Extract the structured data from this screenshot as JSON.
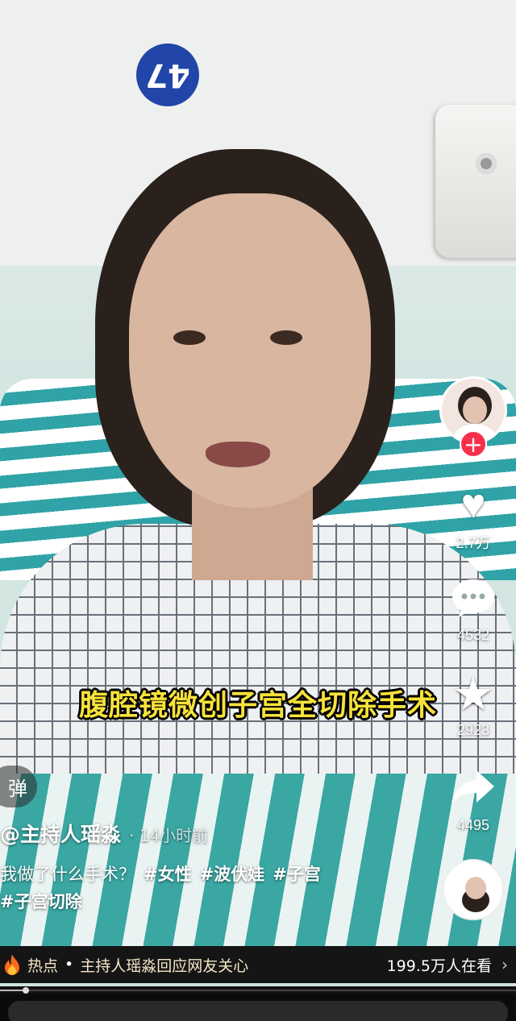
{
  "video": {
    "room_number": "47",
    "caption": "腹腔镜微创子宫全切除手术",
    "colors": {
      "caption": "#f7e23a",
      "follow": "#f6304a",
      "hot_bar": "#151515"
    }
  },
  "rail": {
    "avatar_icon": "creator-avatar",
    "follow_symbol": "+",
    "like_count": "2.7万",
    "comment_count": "4532",
    "favorite_count": "2923",
    "share_count": "4495",
    "icons": {
      "like": "heart-icon",
      "comment": "comment-bubble-icon",
      "favorite": "star-icon",
      "share": "share-arrow-icon",
      "music": "music-disc-icon"
    }
  },
  "danmu": {
    "label": "弹"
  },
  "author": {
    "name": "@主持人瑶淼",
    "time": "· 14小时前"
  },
  "description": {
    "text": "我做了什么手术？",
    "tags": [
      "#女性",
      "#波伏娃",
      "#子宫",
      "#子宫切除"
    ]
  },
  "hot_bar": {
    "icon": "fire-icon",
    "label": "热点",
    "separator": "•",
    "topic": "主持人瑶淼回应网友关心",
    "viewers": "199.5万人在看",
    "chevron": "›"
  },
  "progress": {
    "fraction": 0.05
  }
}
